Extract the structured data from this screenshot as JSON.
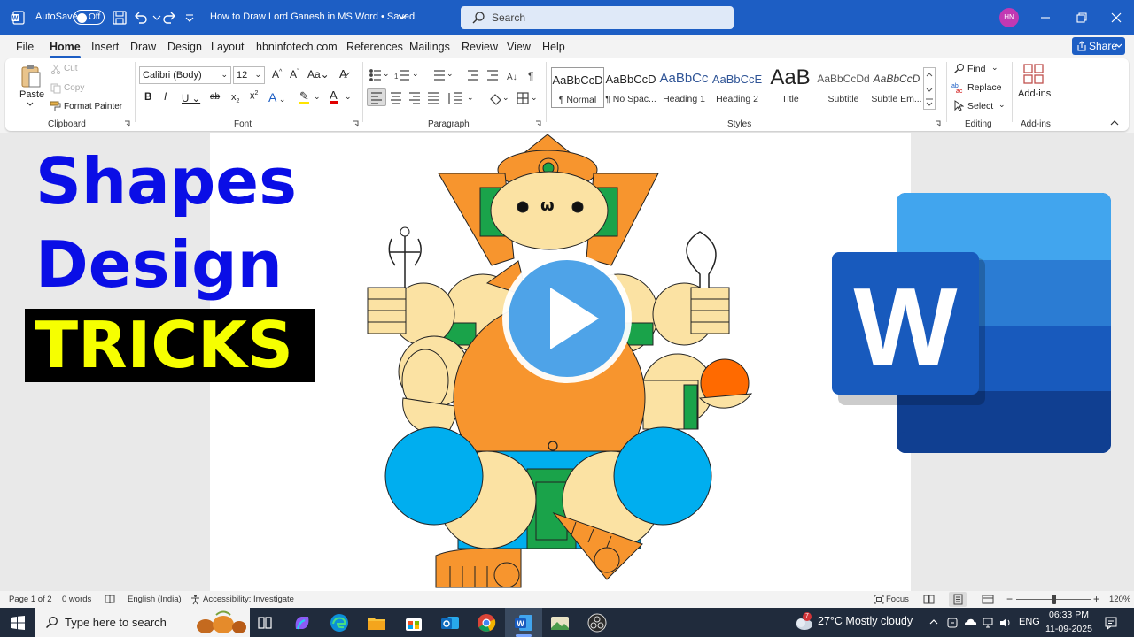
{
  "titlebar": {
    "autosave_label": "AutoSave",
    "autosave_state": "Off",
    "document_title": "How to Draw Lord Ganesh in MS Word • Saved",
    "search_placeholder": "Search",
    "user_initials": "HN"
  },
  "menu": {
    "tabs": [
      "File",
      "Home",
      "Insert",
      "Draw",
      "Design",
      "Layout",
      "hbninfotech.com",
      "References",
      "Mailings",
      "Review",
      "View",
      "Help"
    ],
    "active": "Home",
    "share_label": "Share"
  },
  "ribbon": {
    "clipboard": {
      "paste": "Paste",
      "cut": "Cut",
      "copy": "Copy",
      "format_painter": "Format Painter",
      "label": "Clipboard"
    },
    "font": {
      "family": "Calibri (Body)",
      "size": "12",
      "label": "Font"
    },
    "paragraph": {
      "label": "Paragraph"
    },
    "styles": {
      "label": "Styles",
      "items": [
        {
          "preview": "AaBbCcD",
          "name": "¶ Normal"
        },
        {
          "preview": "AaBbCcD",
          "name": "¶ No Spac..."
        },
        {
          "preview": "AaBbCc",
          "name": "Heading 1"
        },
        {
          "preview": "AaBbCcE",
          "name": "Heading 2"
        },
        {
          "preview": "AaB",
          "name": "Title"
        },
        {
          "preview": "AaBbCcDd",
          "name": "Subtitle"
        },
        {
          "preview": "AaBbCcD",
          "name": "Subtle Em..."
        }
      ]
    },
    "editing": {
      "find": "Find",
      "replace": "Replace",
      "select": "Select",
      "label": "Editing"
    },
    "addins": {
      "button": "Add-ins",
      "label": "Add-ins"
    }
  },
  "thumbnail": {
    "line1": "Shapes",
    "line2": "Design",
    "line3": "TRICKS"
  },
  "statusbar": {
    "page": "Page 1 of 2",
    "words": "0 words",
    "language": "English (India)",
    "accessibility": "Accessibility: Investigate",
    "focus": "Focus",
    "zoom": "120%"
  },
  "taskbar": {
    "search_placeholder": "Type here to search",
    "weather_badge": "7",
    "weather": "27°C  Mostly cloudy",
    "lang": "ENG",
    "time": "06:33 PM",
    "date": "11-09-2025"
  },
  "colors": {
    "accent": "#1d5ec4",
    "ganesh_orange": "#f7952e",
    "ganesh_cream": "#fbe2a3",
    "ganesh_blue": "#00aeef",
    "ganesh_green": "#1aa34a",
    "heading_blue": "#0a0ee6",
    "tricks_yellow": "#f6ff00"
  }
}
